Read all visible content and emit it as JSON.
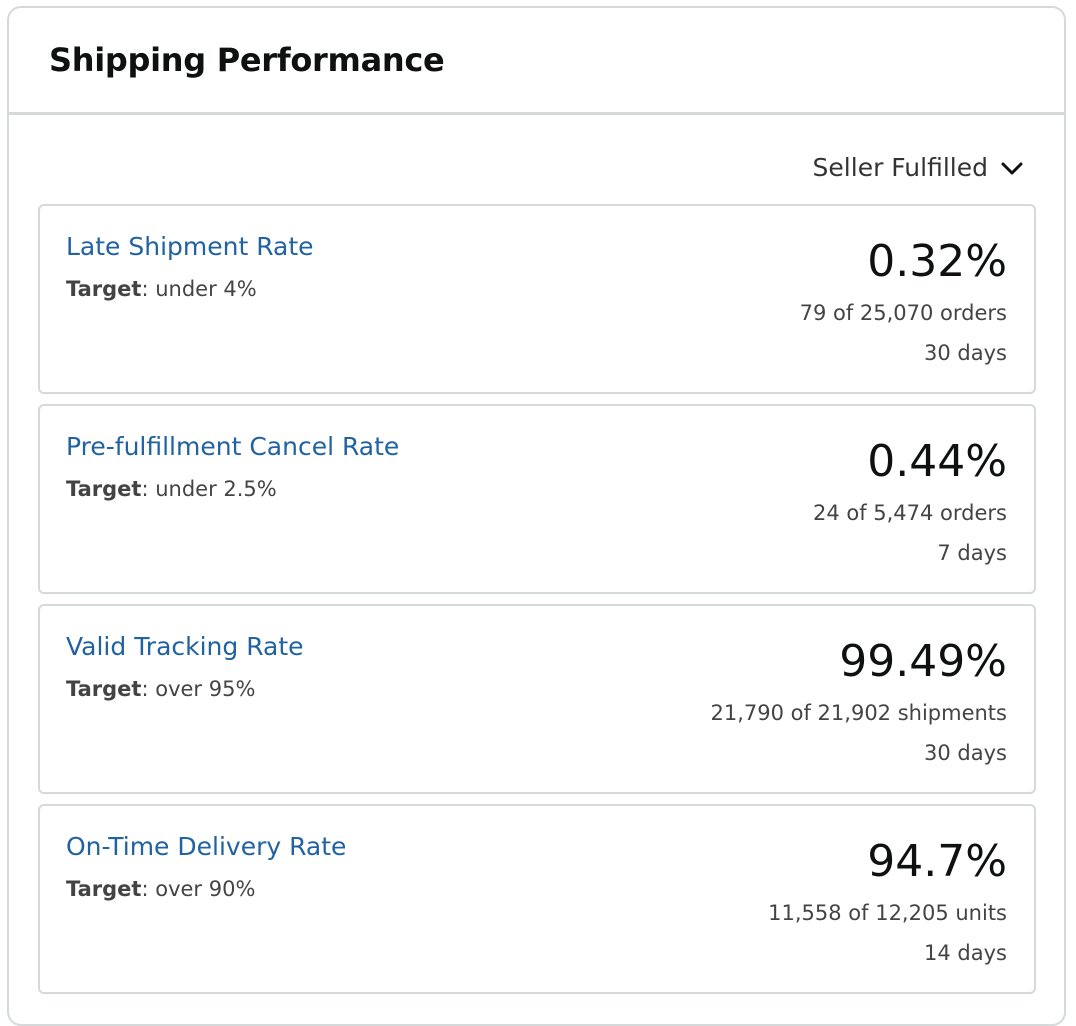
{
  "panel": {
    "title": "Shipping Performance"
  },
  "filter": {
    "label": "Seller Fulfilled",
    "icon": "chevron-down-icon"
  },
  "metrics": [
    {
      "name": "Late Shipment Rate",
      "target_label": "Target",
      "target_value": ": under 4%",
      "value": "0.32%",
      "count": "79 of 25,070 orders",
      "period": "30 days"
    },
    {
      "name": "Pre-fulfillment Cancel Rate",
      "target_label": "Target",
      "target_value": ": under 2.5%",
      "value": "0.44%",
      "count": "24 of 5,474 orders",
      "period": "7 days"
    },
    {
      "name": "Valid Tracking Rate",
      "target_label": "Target",
      "target_value": ": over 95%",
      "value": "99.49%",
      "count": "21,790 of 21,902 shipments",
      "period": "30 days"
    },
    {
      "name": "On-Time Delivery Rate",
      "target_label": "Target",
      "target_value": ": over 90%",
      "value": "94.7%",
      "count": "11,558 of 12,205 units",
      "period": "14 days"
    }
  ],
  "colors": {
    "link": "#2162a1",
    "border": "#d5d9d9",
    "text": "#0f1111",
    "muted": "#444444"
  }
}
